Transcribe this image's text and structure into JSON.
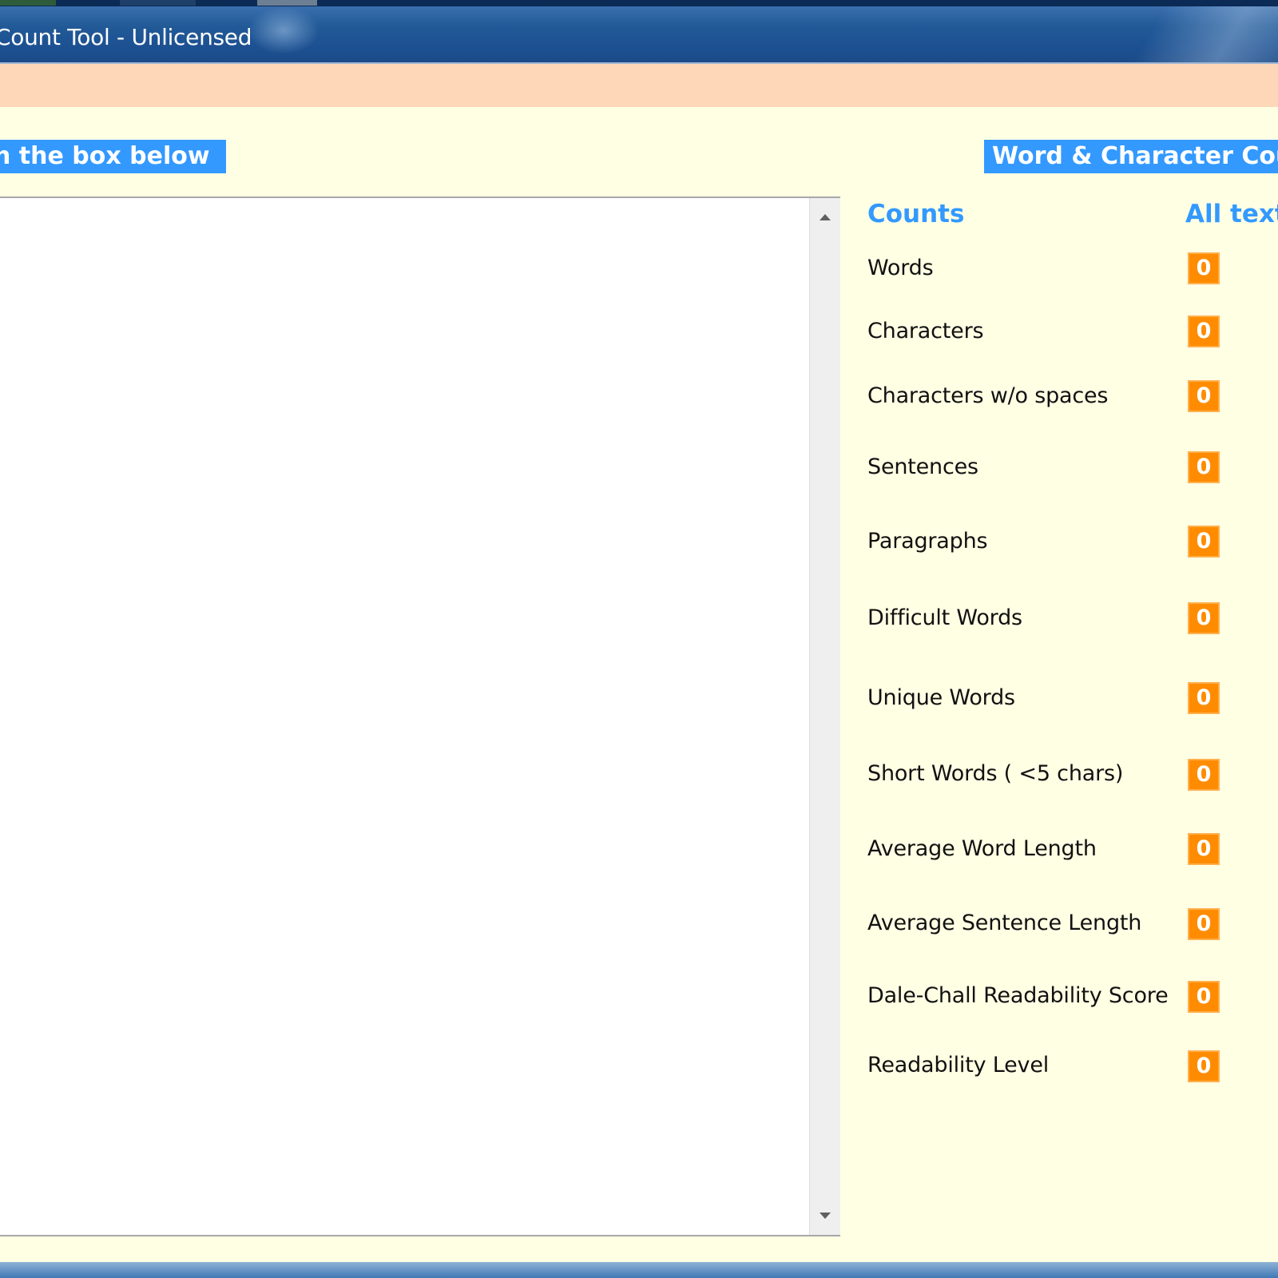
{
  "window": {
    "title": "Count Tool - Unlicensed"
  },
  "left_header": "n the box below",
  "right_header": "Word & Character Cou",
  "text_input": {
    "value": ""
  },
  "counts": {
    "column_label": "Counts",
    "column_value_label": "All text",
    "rows": [
      {
        "label": "Words",
        "value": "0"
      },
      {
        "label": "Characters",
        "value": "0"
      },
      {
        "label": "Characters w/o spaces",
        "value": "0"
      },
      {
        "label": "Sentences",
        "value": "0"
      },
      {
        "label": "Paragraphs",
        "value": "0"
      },
      {
        "label": "Difficult Words",
        "value": "0"
      },
      {
        "label": "Unique Words",
        "value": "0"
      },
      {
        "label": "Short Words ( <5 chars)",
        "value": "0"
      },
      {
        "label": "Average Word Length",
        "value": "0"
      },
      {
        "label": "Average Sentence Length",
        "value": "0"
      },
      {
        "label": "Dale-Chall Readability Score",
        "value": "0"
      },
      {
        "label": "Readability Level",
        "value": "0"
      }
    ]
  },
  "colors": {
    "accent_blue": "#3399ff",
    "value_badge": "#ff8c00",
    "background": "#ffffe4",
    "banner": "#fdd7b8"
  }
}
